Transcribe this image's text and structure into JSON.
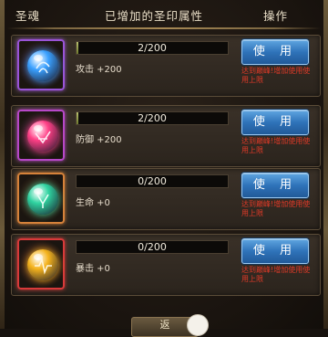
{
  "header": {
    "col_soul": "圣魂",
    "col_attr": "已增加的圣印属性",
    "col_op": "操作"
  },
  "rows": [
    {
      "gem_icon": "blue-orb-icon",
      "frame_color": "#9a54d8",
      "gem_color": "#3aa0ff",
      "progress_text": "2/200",
      "progress_fraction": 0.01,
      "attribute": "攻击 +200",
      "button_label": "使 用",
      "note": "达到巅峰!增加使用使用上限"
    },
    {
      "gem_icon": "pink-orb-icon",
      "frame_color": "#b748c8",
      "gem_color": "#ff3f86",
      "progress_text": "2/200",
      "progress_fraction": 0.01,
      "attribute": "防御 +200",
      "button_label": "使 用",
      "note": "达到巅峰!增加使用使用上限"
    },
    {
      "gem_icon": "green-orb-icon",
      "frame_color": "#d6823a",
      "gem_color": "#2fd3a0",
      "progress_text": "0/200",
      "progress_fraction": 0,
      "attribute": "生命 +0",
      "button_label": "使 用",
      "note": "达到巅峰!增加使用使用上限"
    },
    {
      "gem_icon": "gold-orb-icon",
      "frame_color": "#d83a3a",
      "gem_color": "#f4b21c",
      "progress_text": "0/200",
      "progress_fraction": 0,
      "attribute": "暴击 +0",
      "button_label": "使 用",
      "note": "达到巅峰!增加使用使用上限"
    }
  ],
  "footer": {
    "partial_button_label": "返"
  }
}
